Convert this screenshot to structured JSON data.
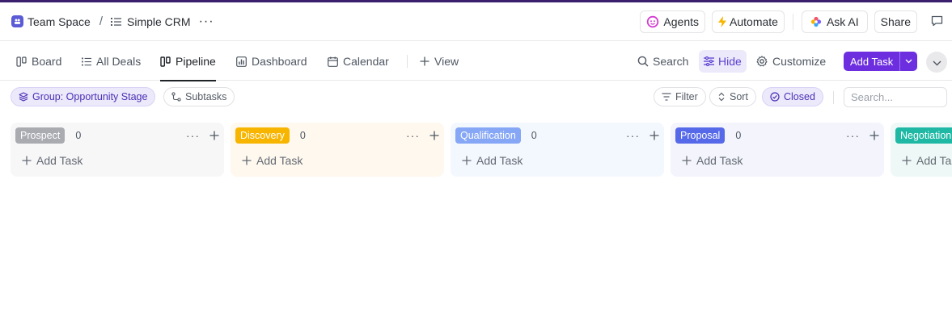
{
  "colors": {
    "accent": "#6d2ee0",
    "prospect": "#a9abb1",
    "discovery": "#f7b500",
    "qualification": "#86a7f5",
    "proposal": "#5669e8",
    "negotiation": "#1fb8a4"
  },
  "breadcrumb": {
    "space": "Team Space",
    "separator": "/",
    "list": "Simple CRM",
    "more": "···"
  },
  "header": {
    "agents": "Agents",
    "automate": "Automate",
    "ask_ai": "Ask AI",
    "share": "Share"
  },
  "views": {
    "tabs": [
      {
        "label": "Board",
        "icon": "board-icon"
      },
      {
        "label": "All Deals",
        "icon": "list-icon"
      },
      {
        "label": "Pipeline",
        "icon": "board-icon",
        "active": true
      },
      {
        "label": "Dashboard",
        "icon": "dashboard-icon"
      },
      {
        "label": "Calendar",
        "icon": "calendar-icon"
      }
    ],
    "add_view": "View",
    "search": "Search",
    "hide": "Hide",
    "customize": "Customize",
    "add_task": "Add Task"
  },
  "filters": {
    "group": "Group: Opportunity Stage",
    "subtasks": "Subtasks",
    "filter": "Filter",
    "sort": "Sort",
    "closed": "Closed",
    "search_placeholder": "Search..."
  },
  "board": {
    "add_task_label": "Add Task",
    "columns": [
      {
        "name": "Prospect",
        "count": "0"
      },
      {
        "name": "Discovery",
        "count": "0"
      },
      {
        "name": "Qualification",
        "count": "0"
      },
      {
        "name": "Proposal",
        "count": "0"
      },
      {
        "name": "Negotiation",
        "count": ""
      }
    ]
  }
}
